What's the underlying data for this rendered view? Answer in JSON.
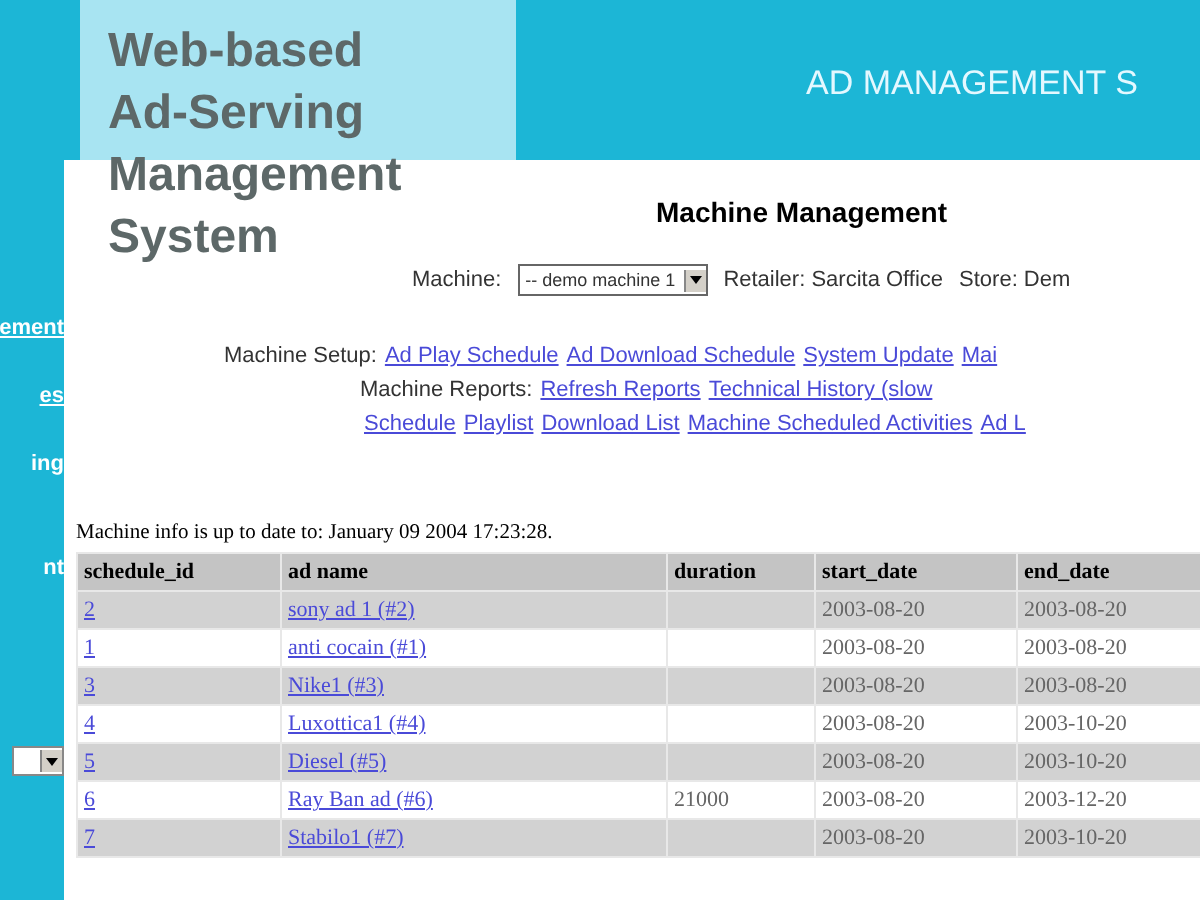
{
  "header": {
    "title": "Web-based Ad-Serving Management System",
    "banner": "AD MANAGEMENT S"
  },
  "sidebar": {
    "items": [
      {
        "label": "ement",
        "link": true
      },
      {
        "label": "es",
        "link": true
      },
      {
        "label": "ing",
        "link": false
      },
      {
        "label": "nt",
        "link": false
      }
    ]
  },
  "page": {
    "heading": "Machine Management",
    "machine_label": "Machine:",
    "machine_value": "-- demo machine 1",
    "retailer": "Retailer: Sarcita Office",
    "store": "Store: Dem"
  },
  "link_rows": [
    {
      "label": "Machine Setup:",
      "links": [
        "Ad Play Schedule",
        "Ad Download Schedule",
        "System Update",
        "Mai"
      ]
    },
    {
      "label": "Machine Reports:",
      "links": [
        "Refresh Reports",
        "Technical History (slow"
      ]
    },
    {
      "label": "",
      "links": [
        "Schedule",
        "Playlist",
        "Download List",
        "Machine Scheduled Activities",
        "Ad L"
      ]
    }
  ],
  "info": "Machine info is up to date to: January 09 2004 17:23:28.",
  "table": {
    "columns": [
      "schedule_id",
      "ad name",
      "duration",
      "start_date",
      "end_date"
    ],
    "rows": [
      [
        "2",
        "sony ad 1 (#2)",
        "",
        "2003-08-20",
        "2003-08-20"
      ],
      [
        "1",
        "anti cocain (#1)",
        "",
        "2003-08-20",
        "2003-08-20"
      ],
      [
        "3",
        "Nike1 (#3)",
        "",
        "2003-08-20",
        "2003-08-20"
      ],
      [
        "4",
        "Luxottica1 (#4)",
        "",
        "2003-08-20",
        "2003-10-20"
      ],
      [
        "5",
        "Diesel (#5)",
        "",
        "2003-08-20",
        "2003-10-20"
      ],
      [
        "6",
        "Ray Ban ad (#6)",
        "21000",
        "2003-08-20",
        "2003-12-20"
      ],
      [
        "7",
        "Stabilo1 (#7)",
        "",
        "2003-08-20",
        "2003-10-20"
      ]
    ]
  }
}
